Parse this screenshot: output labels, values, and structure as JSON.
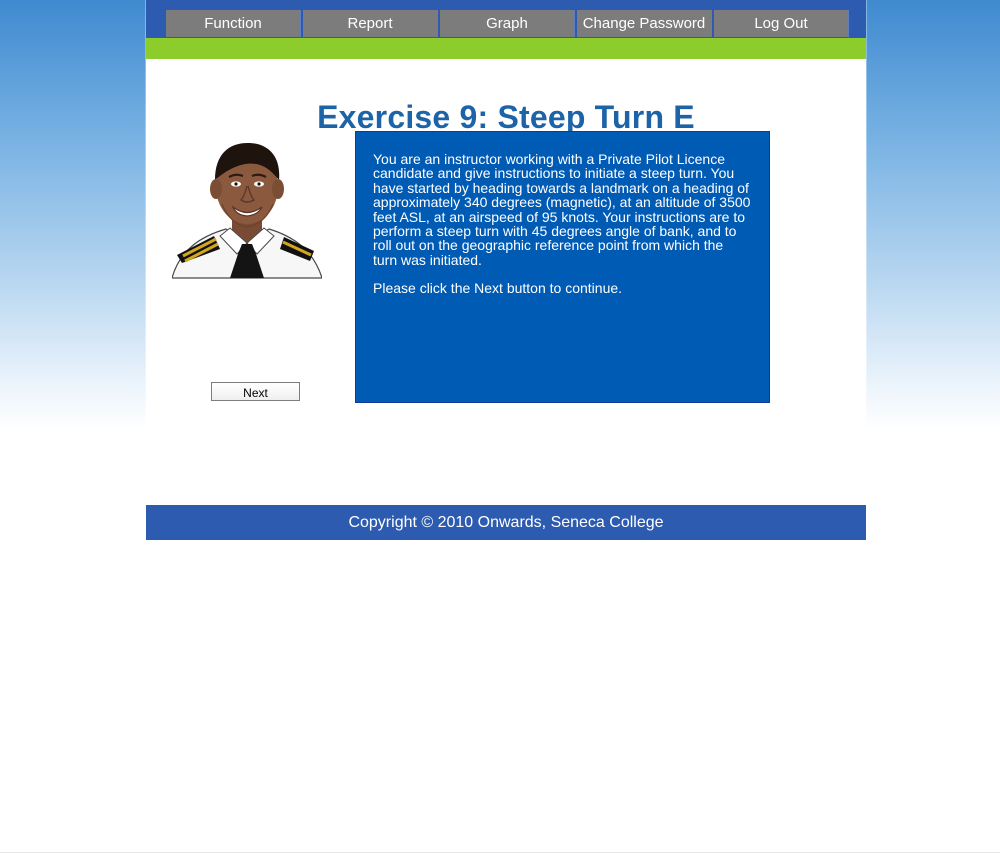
{
  "navigation": {
    "items": [
      {
        "label": "Function"
      },
      {
        "label": "Report"
      },
      {
        "label": "Graph"
      },
      {
        "label": "Change Password"
      },
      {
        "label": "Log Out"
      }
    ]
  },
  "content": {
    "title": "Exercise 9: Steep Turn E",
    "instructions": [
      "You are an instructor working with a Private Pilot Licence candidate and give instructions to initiate a steep turn. You have started by heading towards a landmark on a heading of approximately 340 degrees (magnetic), at an altitude of 3500 feet ASL, at an airspeed of 95 knots. Your instructions are to perform a steep turn with 45 degrees angle of bank, and to roll out on the geographic reference point from which the turn was initiated.",
      "Please click the Next button to continue."
    ],
    "next_label": "Next"
  },
  "footer": {
    "text": "Copyright © 2010 Onwards, Seneca College"
  },
  "colors": {
    "header_blue": "#2c5bb0",
    "menu_gray": "#7c7c7c",
    "accent_green": "#8ccc2b",
    "title_blue": "#1d63a8",
    "panel_blue": "#005bb5"
  },
  "icons": {
    "pilot": "pilot-illustration"
  }
}
